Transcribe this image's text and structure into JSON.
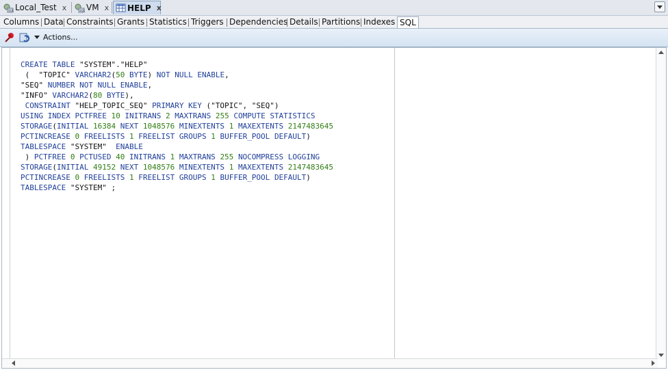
{
  "doc_tabs": [
    {
      "label": "Local_Test",
      "close": "x"
    },
    {
      "label": "VM",
      "close": "x"
    },
    {
      "label": "HELP",
      "close": "x"
    }
  ],
  "sub_tabs": [
    "Columns",
    "Data",
    "Constraints",
    "Grants",
    "Statistics",
    "Triggers",
    "Dependencies",
    "Details",
    "Partitions",
    "Indexes",
    "SQL"
  ],
  "toolbar": {
    "actions_label": "Actions..."
  },
  "sql_lines": [
    "CREATE TABLE \"SYSTEM\".\"HELP\"",
    " (  \"TOPIC\" VARCHAR2(50 BYTE) NOT NULL ENABLE,",
    "\"SEQ\" NUMBER NOT NULL ENABLE,",
    "\"INFO\" VARCHAR2(80 BYTE),",
    " CONSTRAINT \"HELP_TOPIC_SEQ\" PRIMARY KEY (\"TOPIC\", \"SEQ\")",
    "USING INDEX PCTFREE 10 INITRANS 2 MAXTRANS 255 COMPUTE STATISTICS",
    "STORAGE(INITIAL 16384 NEXT 1048576 MINEXTENTS 1 MAXEXTENTS 2147483645",
    "PCTINCREASE 0 FREELISTS 1 FREELIST GROUPS 1 BUFFER_POOL DEFAULT)",
    "TABLESPACE \"SYSTEM\"  ENABLE",
    " ) PCTFREE 0 PCTUSED 40 INITRANS 1 MAXTRANS 255 NOCOMPRESS LOGGING",
    "STORAGE(INITIAL 49152 NEXT 1048576 MINEXTENTS 1 MAXEXTENTS 2147483645",
    "PCTINCREASE 0 FREELISTS 1 FREELIST GROUPS 1 BUFFER_POOL DEFAULT)",
    "TABLESPACE \"SYSTEM\" ;"
  ],
  "colors": {
    "keyword": "#1f3f9a",
    "number": "#2f7d12",
    "active_tab": "#cfdcee"
  }
}
